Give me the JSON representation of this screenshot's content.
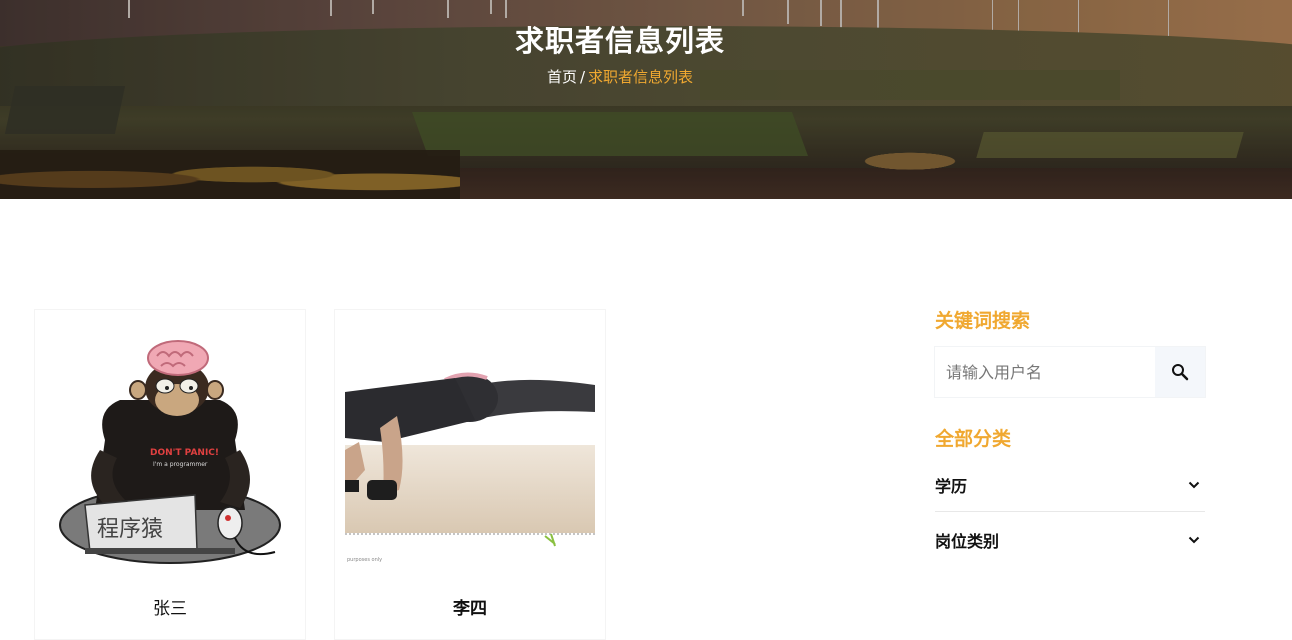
{
  "header": {
    "title": "求职者信息列表",
    "breadcrumb": {
      "home": "首页",
      "separator": "/",
      "current": "求职者信息列表"
    }
  },
  "seekers": [
    {
      "name": "张三",
      "photo_caption": "程序猿",
      "shirt_text": "DON'T PANIC!",
      "shirt_sub": "I'm a programmer"
    },
    {
      "name": "李四",
      "photo_footnote": "purposes only"
    }
  ],
  "sidebar": {
    "keyword_heading": "关键词搜索",
    "search": {
      "placeholder": "请输入用户名",
      "value": ""
    },
    "category_heading": "全部分类",
    "filters": [
      {
        "label": "学历"
      },
      {
        "label": "岗位类别"
      }
    ]
  },
  "colors": {
    "accent": "#f0a830",
    "text": "#111111",
    "divider": "#e8e8e8"
  },
  "icons": {
    "search": "magnifier-icon",
    "expand": "chevron-down-icon"
  }
}
